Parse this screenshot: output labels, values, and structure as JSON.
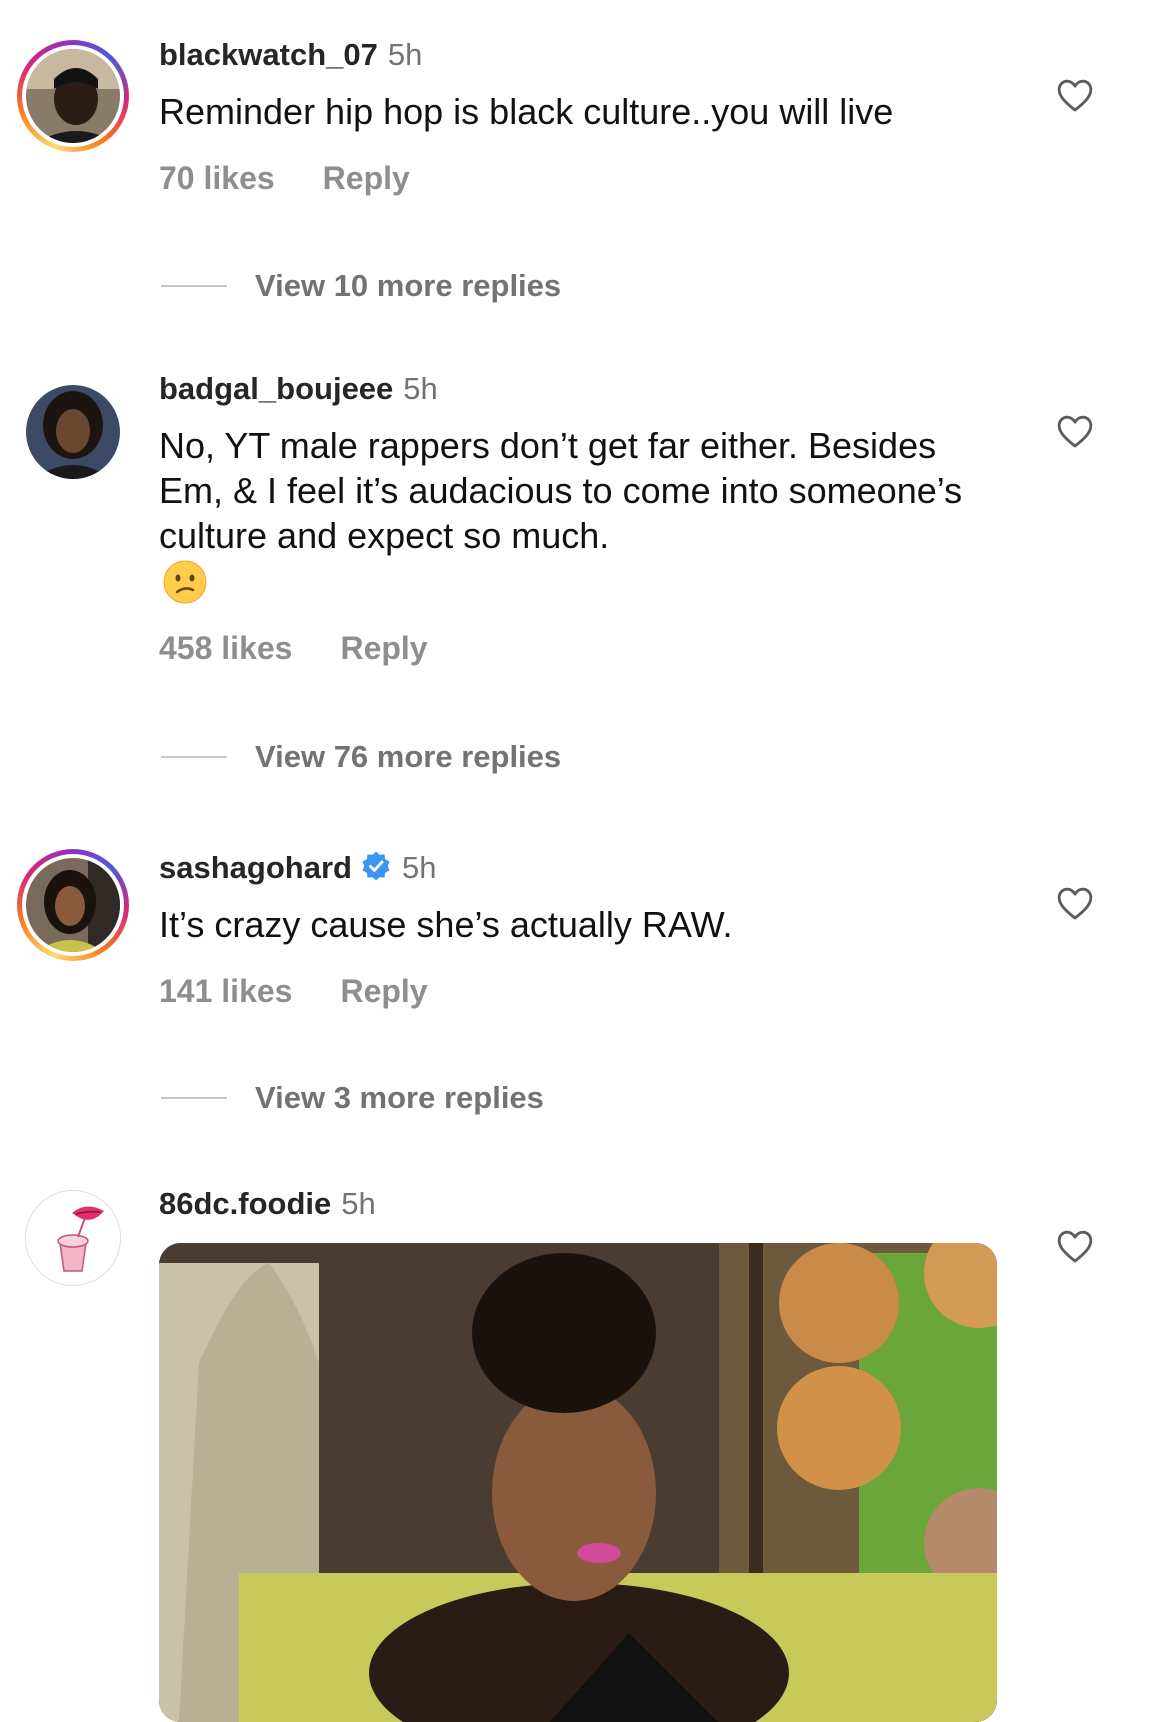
{
  "comments": [
    {
      "username": "blackwatch_07",
      "time": "5h",
      "text": "Reminder hip hop is black culture..you will live",
      "likes": "70 likes",
      "reply": "Reply",
      "view_replies": "View 10 more replies"
    },
    {
      "username": "badgal_boujeee",
      "time": "5h",
      "text": "No, YT male rappers don’t get far either. Besides Em, & I feel it’s audacious to come into someone’s culture and expect so much.",
      "likes": "458 likes",
      "reply": "Reply",
      "view_replies": "View 76 more replies"
    },
    {
      "username": "sashagohard",
      "time": "5h",
      "text": "It’s crazy cause she’s actually RAW.",
      "likes": "141 likes",
      "reply": "Reply",
      "view_replies": "View 3 more replies"
    },
    {
      "username": "86dc.foodie",
      "time": "5h"
    }
  ],
  "icons": {
    "like": "heart-outline-icon",
    "verified": "verified-badge-icon",
    "emoji": "confused-face-emoji"
  },
  "colors": {
    "verified": "#3897f0",
    "muted_text": "#8e8e8e"
  }
}
